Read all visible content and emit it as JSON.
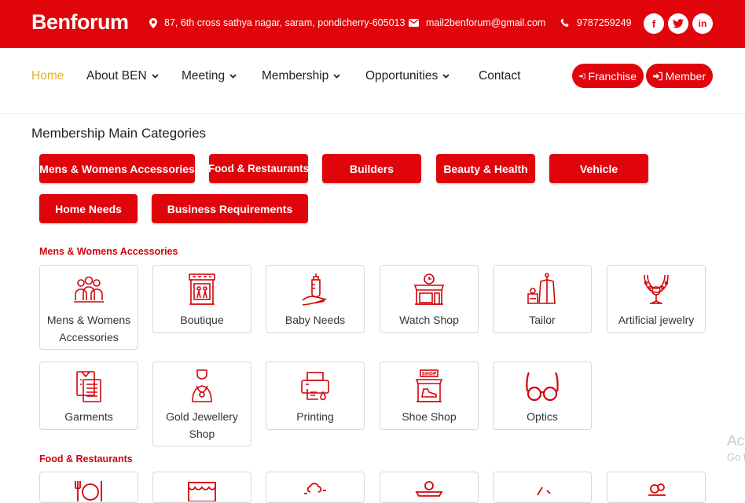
{
  "topbar": {
    "brand": "Benforum",
    "address": "87, 6th cross sathya nagar, saram, pondicherry-605013",
    "email": "mail2benforum@gmail.com",
    "phone": "9787259249",
    "social": [
      "f",
      "t",
      "in"
    ]
  },
  "nav": {
    "items": [
      {
        "label": "Home",
        "active": true
      },
      {
        "label": "About BEN",
        "dropdown": true
      },
      {
        "label": "Meeting",
        "dropdown": true
      },
      {
        "label": "Membership",
        "dropdown": true
      },
      {
        "label": "Opportunities",
        "dropdown": true
      },
      {
        "label": "Contact"
      }
    ],
    "franchise_label": "Franchise",
    "member_label": "Member"
  },
  "main": {
    "title": "Membership Main Categories",
    "categories": [
      "Mens & Womens Accessories",
      "Food & Restaurants",
      "Builders",
      "Beauty & Health",
      "Vehicle",
      "Home Needs",
      "Business Requirements"
    ],
    "section1": {
      "heading": "Mens & Womens Accessories",
      "cards": [
        {
          "label": "Mens & Womens Accessories",
          "icon": "people-icon"
        },
        {
          "label": "Boutique",
          "icon": "boutique-icon"
        },
        {
          "label": "Baby Needs",
          "icon": "baby-bottle-icon"
        },
        {
          "label": "Watch Shop",
          "icon": "watch-shop-icon"
        },
        {
          "label": "Tailor",
          "icon": "tailor-icon"
        },
        {
          "label": "Artificial jewelry",
          "icon": "necklace-icon"
        },
        {
          "label": "Garments",
          "icon": "garments-icon"
        },
        {
          "label": "Gold Jewellery Shop",
          "icon": "jewellery-bust-icon"
        },
        {
          "label": "Printing",
          "icon": "printer-icon"
        },
        {
          "label": "Shoe Shop",
          "icon": "shoe-shop-icon"
        },
        {
          "label": "Optics",
          "icon": "glasses-icon"
        }
      ]
    },
    "section2": {
      "heading": "Food & Restaurants"
    }
  },
  "watermark": {
    "line1": "Act",
    "line2": "Go t"
  },
  "colors": {
    "brand": "#e0040b",
    "active_nav": "#e6b12b"
  }
}
